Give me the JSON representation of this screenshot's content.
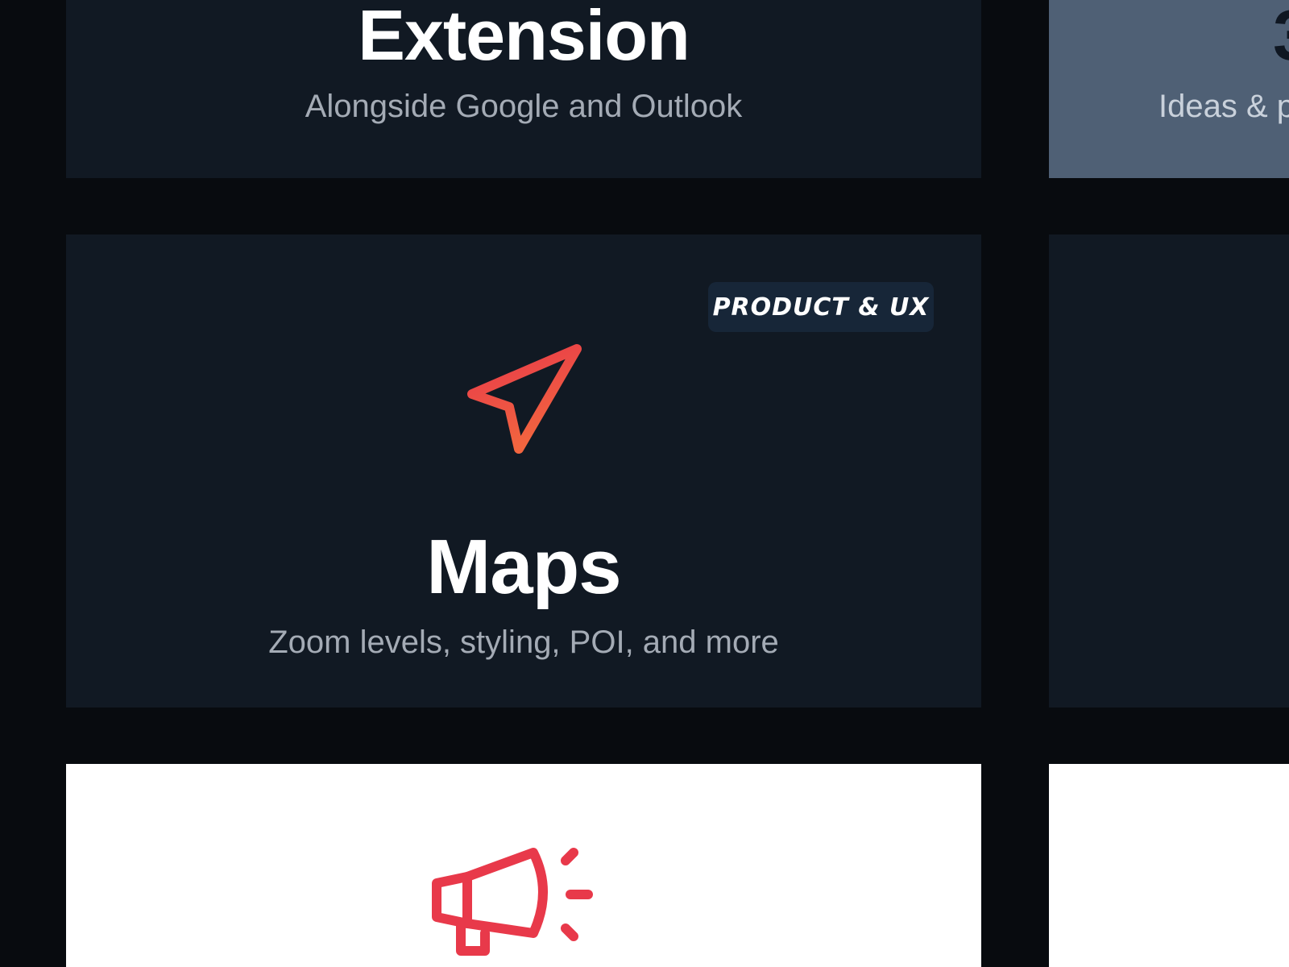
{
  "cards": {
    "extension": {
      "title": "Extension",
      "subtitle": "Alongside Google and Outlook"
    },
    "partial_right_top": {
      "title_fragment": "3",
      "subtitle_fragment": "Ideas & p"
    },
    "maps": {
      "title": "Maps",
      "subtitle": "Zoom levels, styling, POI, and more",
      "badge": "PRODUCT & UX",
      "icon": "navigation-arrow-icon"
    },
    "announcement": {
      "icon": "megaphone-icon"
    }
  },
  "colors": {
    "page_background": "#080b0f",
    "card_dark": "#111923",
    "card_slate": "#4f6075",
    "card_light": "#ffffff",
    "badge_background": "#172638",
    "accent_red": "#e8394a",
    "accent_orange": "#f2653f",
    "subtitle_gray": "#a4abb5"
  }
}
